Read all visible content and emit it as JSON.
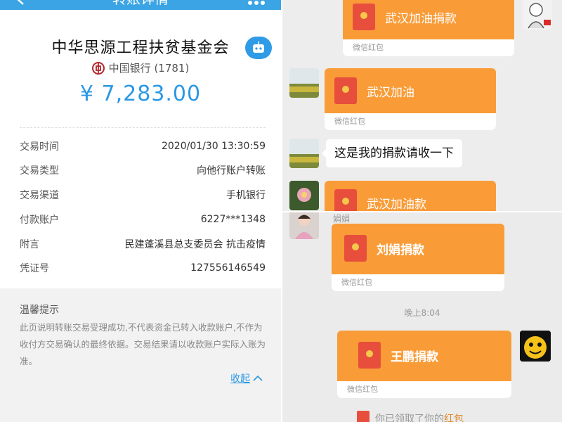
{
  "left": {
    "nav_title": "转账详情",
    "org_name": "中华思源工程扶贫基金会",
    "bank_name": "中国银行 (1781)",
    "amount": "¥ 7,283.00",
    "details": [
      {
        "label": "交易时间",
        "value": "2020/01/30 13:30:59"
      },
      {
        "label": "交易类型",
        "value": "向他行账户转账"
      },
      {
        "label": "交易渠道",
        "value": "手机银行"
      },
      {
        "label": "付款账户",
        "value": "6227***1348"
      },
      {
        "label": "附言",
        "value": "民建蓬溪县总支委员会 抗击疫情"
      },
      {
        "label": "凭证号",
        "value": "127556146549"
      }
    ],
    "tips_title": "温馨提示",
    "tips_text": "此页说明转账交易受理成功,不代表资金已转入收款账户,不作为收付方交易确认的最终依据。交易结果请以收款账户实际入账为准。",
    "collapse_label": "收起"
  },
  "chat_a": {
    "messages": [
      {
        "title": "武汉加油捐款",
        "footer": "微信红包"
      },
      {
        "title": "武汉加油",
        "footer": "微信红包"
      },
      {
        "text": "这是我的捐款请收一下"
      },
      {
        "title": "武汉加油款"
      }
    ]
  },
  "chat_b": {
    "sender_name": "娟娟",
    "messages": [
      {
        "title": "刘娟捐款",
        "footer": "微信红包"
      },
      {
        "title": "王鹏捐款",
        "footer": "微信红包"
      }
    ],
    "timestamp": "晚上8:04",
    "notice_text": "你已领取了你的",
    "notice_link": "红包"
  },
  "colors": {
    "blue": "#2a98e4",
    "orange": "#f99c38",
    "red": "#e84e3c"
  }
}
